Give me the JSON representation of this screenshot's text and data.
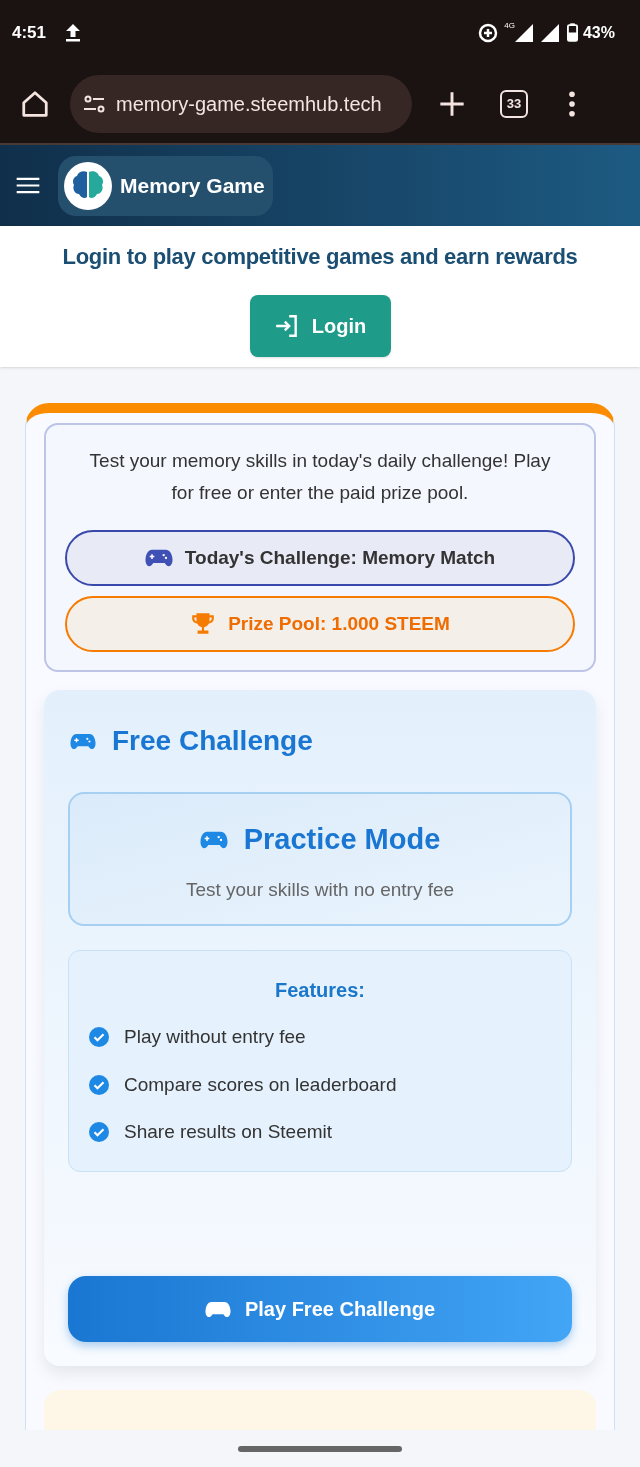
{
  "status_bar": {
    "time": "4:51",
    "network": "4G",
    "battery": "43%"
  },
  "browser": {
    "url": "memory-game.steemhub.tech",
    "tab_count": "33"
  },
  "header": {
    "title": "Memory Game"
  },
  "login": {
    "message": "Login to play competitive games and earn rewards",
    "button": "Login"
  },
  "challenge": {
    "intro": "Test your memory skills in today's daily challenge! Play for free or enter the paid prize pool.",
    "badges": [
      {
        "kind": "challenge",
        "text": "Today's Challenge: Memory Match"
      },
      {
        "kind": "prize",
        "text": "Prize Pool: 1.000 STEEM"
      }
    ]
  },
  "free_challenge": {
    "title": "Free Challenge",
    "mode_title": "Practice Mode",
    "mode_subtitle": "Test your skills with no entry fee",
    "features_heading": "Features:",
    "features": [
      {
        "text": "Play without entry fee",
        "checked": true
      },
      {
        "text": "Compare scores on leaderboard",
        "checked": true
      },
      {
        "text": "Share results on Steemit",
        "checked": true
      }
    ],
    "play_button": "Play Free Challenge"
  }
}
